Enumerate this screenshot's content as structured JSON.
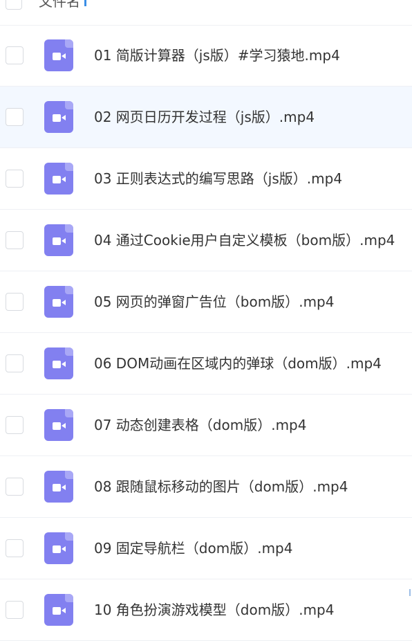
{
  "header": {
    "label": "文件名"
  },
  "files": [
    {
      "name": "01 简版计算器（js版）#学习猿地.mp4"
    },
    {
      "name": "02 网页日历开发过程（js版）.mp4"
    },
    {
      "name": "03 正则表达式的编写思路（js版）.mp4"
    },
    {
      "name": "04 通过Cookie用户自定义模板（bom版）.mp4"
    },
    {
      "name": "05 网页的弹窗广告位（bom版）.mp4"
    },
    {
      "name": "06 DOM动画在区域内的弹球（dom版）.mp4"
    },
    {
      "name": "07 动态创建表格（dom版）.mp4"
    },
    {
      "name": "08 跟随鼠标移动的图片（dom版）.mp4"
    },
    {
      "name": "09 固定导航栏（dom版）.mp4"
    },
    {
      "name": "10 角色扮演游戏模型（dom版）.mp4"
    }
  ],
  "icons": {
    "file_type": "video-file-icon"
  },
  "colors": {
    "icon_bg": "#8280f0",
    "row_hover_bg": "#f3f8ff",
    "divider": "#eef0f4",
    "sort_indicator": "#3a8ee6"
  }
}
